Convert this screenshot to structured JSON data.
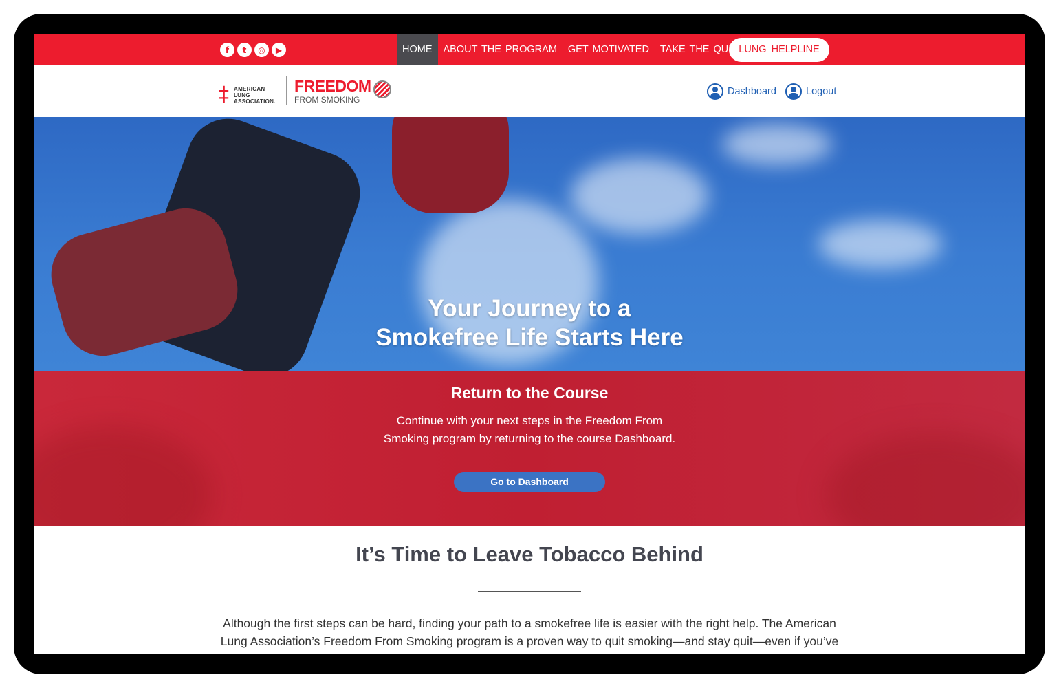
{
  "nav": {
    "social": [
      {
        "name": "facebook-icon",
        "glyph": "f"
      },
      {
        "name": "twitter-icon",
        "glyph": "t"
      },
      {
        "name": "instagram-icon",
        "glyph": "◎"
      },
      {
        "name": "youtube-icon",
        "glyph": "▶"
      }
    ],
    "items": [
      "HOME",
      "ABOUT  THE PROGRAM",
      "GET  MOTIVATED",
      "TAKE THE  QUIZ"
    ],
    "active_index": 0,
    "helpline": "LUNG  HELPLINE"
  },
  "header": {
    "logo_org": "AMERICAN\nLUNG\nASSOCIATION.",
    "logo_title": "FREEDOM",
    "logo_subtitle": "FROM SMOKING",
    "links": [
      "Dashboard",
      "Logout"
    ]
  },
  "hero": {
    "title": "Your Journey to a\nSmokefree Life Starts Here"
  },
  "band": {
    "title": "Return to the Course",
    "text": "Continue with your next steps in the Freedom From Smoking program by returning to the course Dashboard.",
    "button": "Go to Dashboard"
  },
  "content": {
    "title": "It’s Time to Leave Tobacco Behind",
    "body": "Although the first steps can be hard, finding your path to a smokefree life is easier with the right help. The American Lung Association’s Freedom From Smoking program is a proven way to quit smoking—and stay quit—even if you’ve"
  },
  "colors": {
    "brand_red": "#ed1c2e",
    "nav_active": "#4a4a4f",
    "link_blue": "#1f5fb3",
    "button_blue": "#3b73c4",
    "heading_gray": "#444650"
  }
}
